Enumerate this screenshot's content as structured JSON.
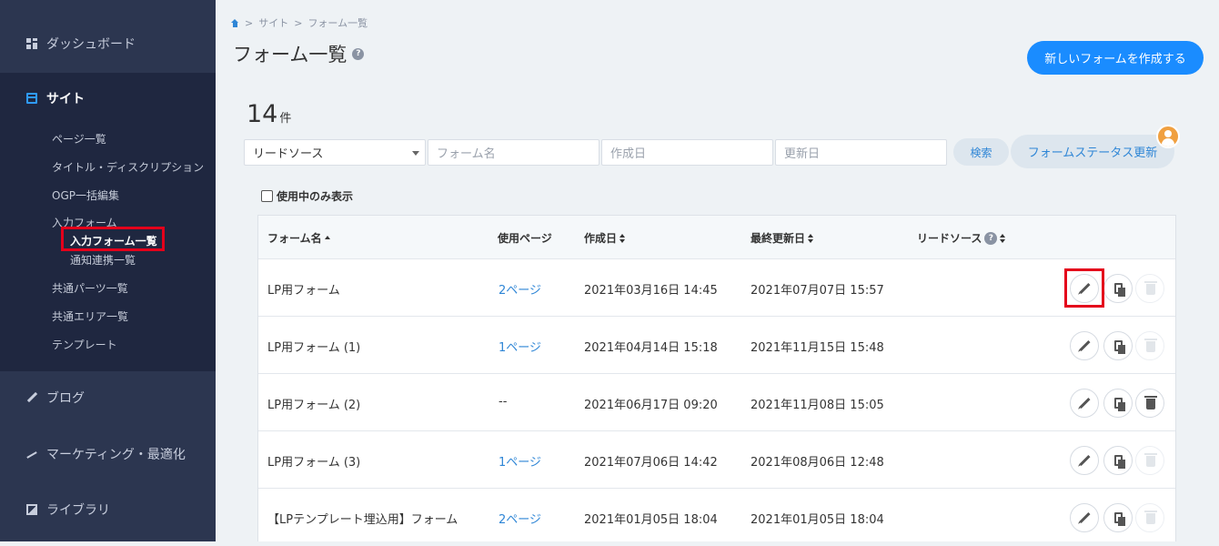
{
  "sidebar": {
    "dashboard": "ダッシュボード",
    "site": "サイト",
    "site_items": [
      "ページ一覧",
      "タイトル・ディスクリプション",
      "OGP一括編集",
      "入力フォーム",
      "入力フォーム一覧",
      "通知連携一覧",
      "共通パーツ一覧",
      "共通エリア一覧",
      "テンプレート"
    ],
    "blog": "ブログ",
    "marketing": "マーケティング・最適化",
    "library": "ライブラリ"
  },
  "breadcrumb": {
    "sep1": ">",
    "site": "サイト",
    "sep2": ">",
    "current": "フォーム一覧"
  },
  "page": {
    "title": "フォーム一覧",
    "help": "?",
    "create_button": "新しいフォームを作成する"
  },
  "count": {
    "value": "14",
    "unit": "件"
  },
  "filters": {
    "lead_source": "リードソース",
    "form_name_placeholder": "フォーム名",
    "created_placeholder": "作成日",
    "updated_placeholder": "更新日",
    "search_button": "検索",
    "status_button": "フォームステータス更新"
  },
  "only_in_use": "使用中のみ表示",
  "table": {
    "headers": {
      "name": "フォーム名",
      "pages": "使用ページ",
      "created": "作成日",
      "updated": "最終更新日",
      "lead_source": "リードソース",
      "help": "?"
    },
    "rows": [
      {
        "name": "LP用フォーム",
        "pages": "2ページ",
        "created": "2021年03月16日 14:45",
        "updated": "2021年07月07日 15:57",
        "delete_enabled": false
      },
      {
        "name": "LP用フォーム (1)",
        "pages": "1ページ",
        "created": "2021年04月14日 15:18",
        "updated": "2021年11月15日 15:48",
        "delete_enabled": false
      },
      {
        "name": "LP用フォーム (2)",
        "pages": "--",
        "created": "2021年06月17日 09:20",
        "updated": "2021年11月08日 15:05",
        "delete_enabled": true
      },
      {
        "name": "LP用フォーム (3)",
        "pages": "1ページ",
        "created": "2021年07月06日 14:42",
        "updated": "2021年08月06日 12:48",
        "delete_enabled": false
      },
      {
        "name": "【LPテンプレート埋込用】フォーム",
        "pages": "2ページ",
        "created": "2021年01月05日 18:04",
        "updated": "2021年01月05日 18:04",
        "delete_enabled": false
      }
    ]
  },
  "colors": {
    "sidebar": "#2c3650",
    "sidebar_active": "#1f2740",
    "primary": "#1a8cff",
    "link": "#2f86d6",
    "highlight": "#e4001b"
  }
}
